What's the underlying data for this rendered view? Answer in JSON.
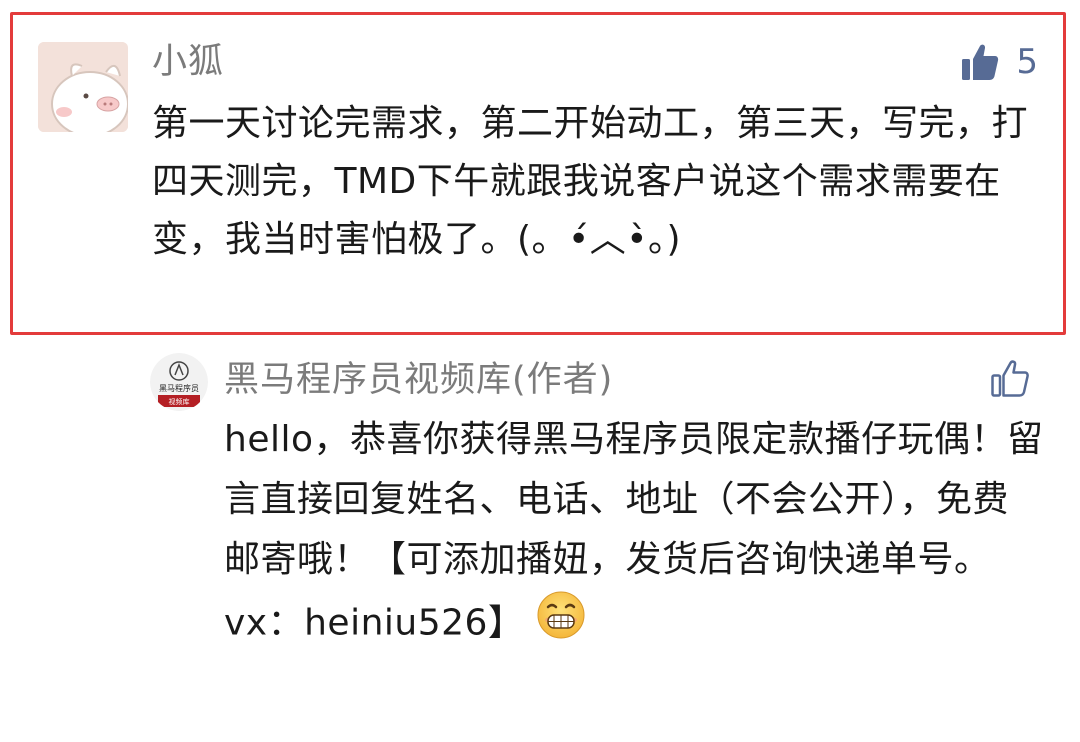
{
  "comment": {
    "author": "小狐",
    "like_count": "5",
    "text": "第一天讨论完需求，第二开始动工，第三天，写完，打四天测完，TMD下午就跟我说客户说这个需求需要在变，我当时害怕极了。(。•́︿•̀。)"
  },
  "reply": {
    "author": "黑马程序员视频库(作者)",
    "text": "hello，恭喜你获得黑马程序员限定款播仔玩偶！留言直接回复姓名、电话、地址（不会公开），免费邮寄哦！【可添加播妞，发货后咨询快递单号。vx：heiniu526】",
    "avatar_text_top": "黑马程序员",
    "avatar_text_bottom": "视频库"
  },
  "colors": {
    "highlight_border": "#e33b3b",
    "like_blue": "#576b95",
    "name_gray": "#7b7b7b"
  },
  "icons": {
    "comment_like": "thumbs-up-filled-icon",
    "reply_like": "thumbs-up-outline-icon",
    "emoji": "grinning-emoji"
  }
}
